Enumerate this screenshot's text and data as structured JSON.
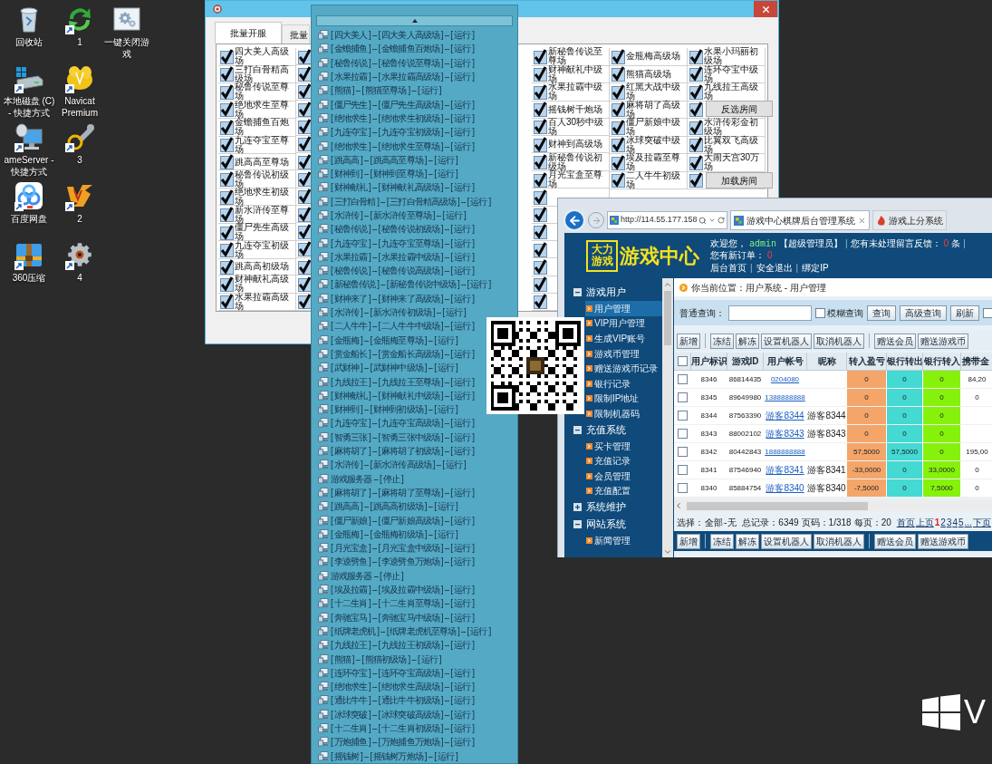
{
  "desktop": {
    "rows": [
      {
        "icons": [
          {
            "label": "回收站",
            "kind": "bin",
            "shortcut": false
          },
          {
            "label": "1",
            "kind": "sync",
            "shortcut": true
          },
          {
            "label": "一键关闭游戏",
            "kind": "settings-window",
            "shortcut": false
          }
        ]
      },
      {
        "icons": [
          {
            "label": "本地磁盘 (C) - 快捷方式",
            "kind": "drive",
            "shortcut": true
          },
          {
            "label": "Navicat Premium",
            "kind": "database",
            "shortcut": true
          }
        ]
      },
      {
        "icons": [
          {
            "label": "ameServer - 快捷方式",
            "kind": "server",
            "shortcut": true
          },
          {
            "label": "3",
            "kind": "tool",
            "shortcut": true
          }
        ]
      },
      {
        "icons": [
          {
            "label": "百度网盘",
            "kind": "cloud",
            "shortcut": true
          },
          {
            "label": "2",
            "kind": "vs",
            "shortcut": true
          }
        ]
      },
      {
        "icons": [
          {
            "label": "360压缩",
            "kind": "archive",
            "shortcut": true
          },
          {
            "label": "4",
            "kind": "gear",
            "shortcut": true
          }
        ]
      }
    ]
  },
  "room_window": {
    "tabs": [
      {
        "label": "批量开服",
        "selected": true
      },
      {
        "label": "批量",
        "selected": false
      }
    ],
    "columns": [
      {
        "cells": [
          {
            "label": "四大美人高级场",
            "checked": true
          },
          {
            "label": "三打白骨精高级场",
            "checked": true
          },
          {
            "label": "秘鲁传说至尊场",
            "checked": true
          },
          {
            "label": "绝地求生至尊场",
            "checked": true
          },
          {
            "label": "金蟾捕鱼百炮场",
            "checked": true
          },
          {
            "label": "九连夺宝至尊场",
            "checked": true
          },
          {
            "label": "跳高高至尊场",
            "checked": true
          },
          {
            "label": "秘鲁传说初级场",
            "checked": true
          },
          {
            "label": "绝地求生初级场",
            "checked": true
          },
          {
            "label": "新水浒传至尊场",
            "checked": true
          },
          {
            "label": "僵尸先生高级场",
            "checked": true
          },
          {
            "label": "九连夺宝初级场",
            "checked": true
          },
          {
            "label": "跳高高初级场",
            "checked": true
          },
          {
            "label": "财神献礼高级场",
            "checked": true
          },
          {
            "label": "水果拉霸高级场",
            "checked": true
          }
        ]
      },
      {
        "cells": [
          {
            "checked": true
          },
          {
            "checked": true
          },
          {
            "checked": true
          },
          {
            "checked": true
          },
          {
            "checked": true
          },
          {
            "checked": true
          },
          {
            "checked": true
          },
          {
            "checked": true
          },
          {
            "checked": true
          },
          {
            "checked": true
          },
          {
            "checked": true
          },
          {
            "checked": true
          },
          {
            "checked": true
          },
          {
            "checked": true
          },
          {
            "checked": true
          }
        ]
      },
      {
        "cells": [
          {
            "label": "新秘鲁传说至尊场",
            "checked": true
          },
          {
            "label": "财神献礼中级场",
            "checked": true
          },
          {
            "label": "水果拉霸中级场",
            "checked": true
          },
          {
            "label": "摇钱树千炮场",
            "checked": true
          },
          {
            "label": "百人30秒中级场",
            "checked": true
          },
          {
            "label": "财神到高级场",
            "checked": true
          },
          {
            "label": "新秘鲁传说初级场",
            "checked": true
          },
          {
            "label": "月光宝盒至尊场",
            "checked": true
          },
          {
            "checked": true
          },
          {
            "checked": true
          },
          {
            "checked": true
          },
          {
            "checked": true
          },
          {
            "checked": true
          },
          {
            "checked": true
          },
          {
            "checked": true
          }
        ]
      },
      {
        "cells": [
          {
            "label": "金瓶梅高级场",
            "checked": true
          },
          {
            "label": "熊猫高级场",
            "checked": true
          },
          {
            "label": "红黑大战中级场",
            "checked": true
          },
          {
            "label": "麻将胡了高级场",
            "checked": true
          },
          {
            "label": "僵尸新娘中级场",
            "checked": true
          },
          {
            "label": "冰球突破中级场",
            "checked": true
          },
          {
            "label": "埃及拉霸至尊场",
            "checked": true
          },
          {
            "label": "二人牛牛初级场",
            "checked": true
          }
        ]
      },
      {
        "cells": [
          {
            "label": "水果小玛丽初级场",
            "checked": true
          },
          {
            "label": "连环夺宝中级场",
            "checked": true
          },
          {
            "label": "九线拉王高级场",
            "checked": true
          },
          {
            "checked": true
          },
          {
            "label": "水浒传彩金初级场",
            "checked": true
          },
          {
            "label": "比翼双飞高级场",
            "checked": true
          },
          {
            "label": "大闹天宫30万场",
            "checked": true
          },
          {
            "checked": true
          }
        ]
      }
    ],
    "buttons": [
      "反选房间",
      "加载房间"
    ]
  },
  "server_list": {
    "items": [
      "[ 四大美人 ] -- [ 四大美人高级场 ] -- [ 运行 ]",
      "[ 金蟾捕鱼 ] -- [ 金蟾捕鱼百炮场 ] -- [ 运行 ]",
      "[ 秘鲁传说 ] -- [ 秘鲁传说至尊场 ] -- [ 运行 ]",
      "[ 水果拉霸 ] -- [ 水果拉霸高级场 ] -- [ 运行 ]",
      "[ 熊猫 ] -- [ 熊猫至尊场 ] -- [ 运行 ]",
      "[ 僵尸先生 ] -- [ 僵尸先生高级场 ] -- [ 运行 ]",
      "[ 绝地求生 ] -- [ 绝地求生初级场 ] -- [ 运行 ]",
      "[ 九连夺宝 ] -- [ 九连夺宝初级场 ] -- [ 运行 ]",
      "[ 绝地求生 ] -- [ 绝地求生至尊场 ] -- [ 运行 ]",
      "[ 跳高高 ] -- [ 跳高高至尊场 ] -- [ 运行 ]",
      "[ 财神到 ] -- [ 财神到至尊场 ] -- [ 运行 ]",
      "[ 财神献礼 ] -- [ 财神献礼高级场 ] -- [ 运行 ]",
      "[ 三打白骨精 ] -- [ 三打白骨精高级场 ] -- [ 运行 ]",
      "[ 水浒传 ] -- [ 新水浒传至尊场 ] -- [ 运行 ]",
      "[ 秘鲁传说 ] -- [ 秘鲁传说初级场 ] -- [ 运行 ]",
      "[ 九连夺宝 ] -- [ 九连夺宝至尊场 ] -- [ 运行 ]",
      "[ 水果拉霸 ] -- [ 水果拉霸中级场 ] -- [ 运行 ]",
      "[ 秘鲁传说 ] -- [ 秘鲁传说高级场 ] -- [ 运行 ]",
      "[ 新秘鲁传说 ] -- [ 新秘鲁传说中级场 ] -- [ 运行 ]",
      "[ 财神来了 ] -- [ 财神来了高级场 ] -- [ 运行 ]",
      "[ 水浒传 ] -- [ 新水浒传初级场 ] -- [ 运行 ]",
      "[ 二人牛牛 ] -- [ 二人牛牛中级场 ] -- [ 运行 ]",
      "[ 金瓶梅 ] -- [ 金瓶梅至尊场 ] -- [ 运行 ]",
      "[ 赏金船长 ] -- [ 赏金船长高级场 ] -- [ 运行 ]",
      "[ 武财神 ] -- [ 武财神中级场 ] -- [ 运行 ]",
      "[ 九线拉王 ] -- [ 九线拉王至尊场 ] -- [ 运行 ]",
      "[ 财神献礼 ] -- [ 财神献礼中级场 ] -- [ 运行 ]",
      "[ 财神到 ] -- [ 财神到初级场 ] -- [ 运行 ]",
      "[ 九连夺宝 ] -- [ 九连夺宝高级场 ] -- [ 运行 ]",
      "[ 智勇三张 ] -- [ 智勇三张中级场 ] -- [ 运行 ]",
      "[ 麻将胡了 ] -- [ 麻将胡了初级场 ] -- [ 运行 ]",
      "[ 水浒传 ] -- [ 新水浒传高级场 ] -- [ 运行 ]",
      "游戏服务器 -- [ 停止 ]",
      "[ 麻将胡了 ] -- [ 麻将胡了至尊场 ] -- [ 运行 ]",
      "[ 跳高高 ] -- [ 跳高高初级场 ] -- [ 运行 ]",
      "[ 僵尸新娘 ] -- [ 僵尸新娘高级场 ] -- [ 运行 ]",
      "[ 金瓶梅 ] -- [ 金瓶梅初级场 ] -- [ 运行 ]",
      "[ 月光宝盒 ] -- [ 月光宝盒中级场 ] -- [ 运行 ]",
      "[ 李逵劈鱼 ] -- [ 李逵劈鱼万炮场 ] -- [ 运行 ]",
      "游戏服务器 -- [ 停止 ]",
      "[ 埃及拉霸 ] -- [ 埃及拉霸中级场 ] -- [ 运行 ]",
      "[ 十二生肖 ] -- [ 十二生肖至尊场 ] -- [ 运行 ]",
      "[ 奔驰宝马 ] -- [ 奔驰宝马中级场 ] -- [ 运行 ]",
      "[ 纸牌老虎机 ] -- [ 纸牌老虎机至尊场 ] -- [ 运行 ]",
      "[ 九线拉王 ] -- [ 九线拉王初级场 ] -- [ 运行 ]",
      "[ 熊猫 ] -- [ 熊猫初级场 ] -- [ 运行 ]",
      "[ 连环夺宝 ] -- [ 连环夺宝高级场 ] -- [ 运行 ]",
      "[ 绝地求生 ] -- [ 绝地求生高级场 ] -- [ 运行 ]",
      "[ 通比牛牛 ] -- [ 通比牛牛初级场 ] -- [ 运行 ]",
      "[ 冰球突破 ] -- [ 冰球突破高级场 ] -- [ 运行 ]",
      "[ 十二生肖 ] -- [ 十二生肖初级场 ] -- [ 运行 ]",
      "[ 万炮捕鱼 ] -- [ 万炮捕鱼万炮场 ] -- [ 运行 ]",
      "[ 摇钱树 ] -- [ 摇钱树万炮场 ] -- [ 运行 ]"
    ]
  },
  "browser": {
    "address": "http://114.55.177.158",
    "tabs": [
      {
        "label": "游戏中心棋牌后台管理系统",
        "selected": true
      },
      {
        "label": "游戏上分系统",
        "selected": false
      }
    ],
    "header": {
      "logo_lines": [
        "大力",
        "游戏"
      ],
      "title": "游戏中心",
      "welcome": [
        {
          "text": "欢迎您，",
          "kind": "plain"
        },
        {
          "text": "admin",
          "kind": "user"
        },
        {
          "text": "【超级管理员】",
          "kind": "plain"
        },
        {
          "text": "|",
          "kind": "sep"
        },
        {
          "text": "您有未处理留言反馈：",
          "kind": "plain"
        },
        {
          "text": "0",
          "kind": "count"
        },
        {
          "text": "条",
          "kind": "plain"
        },
        {
          "text": "|",
          "kind": "sep"
        },
        {
          "text": "您有新订单：",
          "kind": "plain"
        },
        {
          "text": "0",
          "kind": "count"
        }
      ],
      "links": [
        {
          "text": "后台首页",
          "kind": "link"
        },
        {
          "text": "|",
          "kind": "sep"
        },
        {
          "text": "安全退出",
          "kind": "link"
        },
        {
          "text": "|",
          "kind": "sep"
        },
        {
          "text": "绑定IP",
          "kind": "link"
        }
      ]
    },
    "sidebar": {
      "groups": [
        {
          "label": "游戏用户",
          "expanded": true,
          "children": [
            {
              "label": "用户管理",
              "selected": true
            },
            {
              "label": "VIP用户管理",
              "selected": false
            },
            {
              "label": "生成VIP账号",
              "selected": false
            },
            {
              "label": "游戏币管理",
              "selected": false
            },
            {
              "label": "赠送游戏币记录",
              "selected": false
            },
            {
              "label": "银行记录",
              "selected": false
            },
            {
              "label": "限制IP地址",
              "selected": false
            },
            {
              "label": "限制机器码",
              "selected": false
            }
          ]
        },
        {
          "label": "充值系统",
          "expanded": true,
          "children": [
            {
              "label": "买卡管理",
              "selected": false
            },
            {
              "label": "充值记录",
              "selected": false
            },
            {
              "label": "会员管理",
              "selected": false
            },
            {
              "label": "充值配置",
              "selected": false
            }
          ]
        },
        {
          "label": "系统维护",
          "expanded": false
        },
        {
          "label": "网站系统",
          "expanded": true,
          "children": [
            {
              "label": "新闻管理",
              "selected": false
            }
          ]
        }
      ]
    },
    "breadcrumb": "你当前位置：用户系统 - 用户管理",
    "search": {
      "label": "普通查询：",
      "fuzzy": {
        "label": "模糊查询",
        "checked": false
      },
      "buttons": [
        "查询",
        "高级查询",
        "刷新"
      ],
      "extra_checked": false
    },
    "toolbar": {
      "groups": [
        [
          "新增"
        ],
        [
          "冻结",
          "解冻",
          "设置机器人",
          "取消机器人"
        ],
        [
          "赠送会员",
          "赠送游戏币"
        ]
      ]
    },
    "table": {
      "all_checked": false,
      "columns": [
        {
          "label": "用户标识",
          "kind": "text"
        },
        {
          "label": "游戏ID",
          "kind": "text"
        },
        {
          "label": "用户帐号",
          "kind": "link"
        },
        {
          "label": "昵称",
          "kind": "text"
        },
        {
          "label": "转入盈亏",
          "kind": "text",
          "color": "#f4a56a"
        },
        {
          "label": "银行转出",
          "kind": "text",
          "color": "#44d9d2"
        },
        {
          "label": "银行转入",
          "kind": "text",
          "color": "#86f20c"
        },
        {
          "label": "携带金",
          "kind": "text"
        }
      ],
      "rows": [
        {
          "checked": false,
          "cells": [
            "8346",
            "86814435",
            "0204080",
            null,
            "0",
            "0",
            "0",
            "84,20"
          ]
        },
        {
          "checked": false,
          "cells": [
            "8345",
            "89649980",
            "1388888888",
            null,
            "0",
            "0",
            "0",
            "0"
          ]
        },
        {
          "checked": false,
          "cells": [
            "8344",
            "87563390",
            "游客8344",
            "游客8344",
            "0",
            "0",
            "0",
            null
          ]
        },
        {
          "checked": false,
          "cells": [
            "8343",
            "88002102",
            "游客8343",
            "游客8343",
            "0",
            "0",
            "0",
            null
          ]
        },
        {
          "checked": false,
          "cells": [
            "8342",
            "80442843",
            "1888888888",
            null,
            "57,5000",
            "57,5000",
            "0",
            "195,00"
          ]
        },
        {
          "checked": false,
          "cells": [
            "8341",
            "87546940",
            "游客8341",
            "游客8341",
            "-33,0000",
            "0",
            "33,0000",
            "0"
          ]
        },
        {
          "checked": false,
          "cells": [
            "8340",
            "85884754",
            "游客8340",
            "游客8340",
            "-7,5000",
            "0",
            "7,5000",
            "0"
          ]
        }
      ]
    },
    "footer": {
      "selection": [
        "选择：",
        "全部",
        "-",
        "无"
      ],
      "stats": [
        "总记录：6349",
        "页码：1/318",
        "每页：20"
      ],
      "pager": [
        {
          "label": "首页",
          "selected": false
        },
        {
          "label": "上页",
          "selected": false
        },
        {
          "label": "1",
          "selected": true
        },
        {
          "label": "2",
          "selected": false
        },
        {
          "label": "3",
          "selected": false
        },
        {
          "label": "4",
          "selected": false
        },
        {
          "label": "5",
          "selected": false
        },
        {
          "label": "...",
          "selected": false
        },
        {
          "label": "下页",
          "selected": false
        }
      ]
    },
    "bottom_toolbar": {
      "groups": [
        [
          "新增"
        ],
        [
          "冻结",
          "解冻",
          "设置机器人",
          "取消机器人"
        ],
        [
          "赠送会员",
          "赠送游戏币"
        ]
      ]
    }
  },
  "os_mark": {
    "text": "V"
  }
}
